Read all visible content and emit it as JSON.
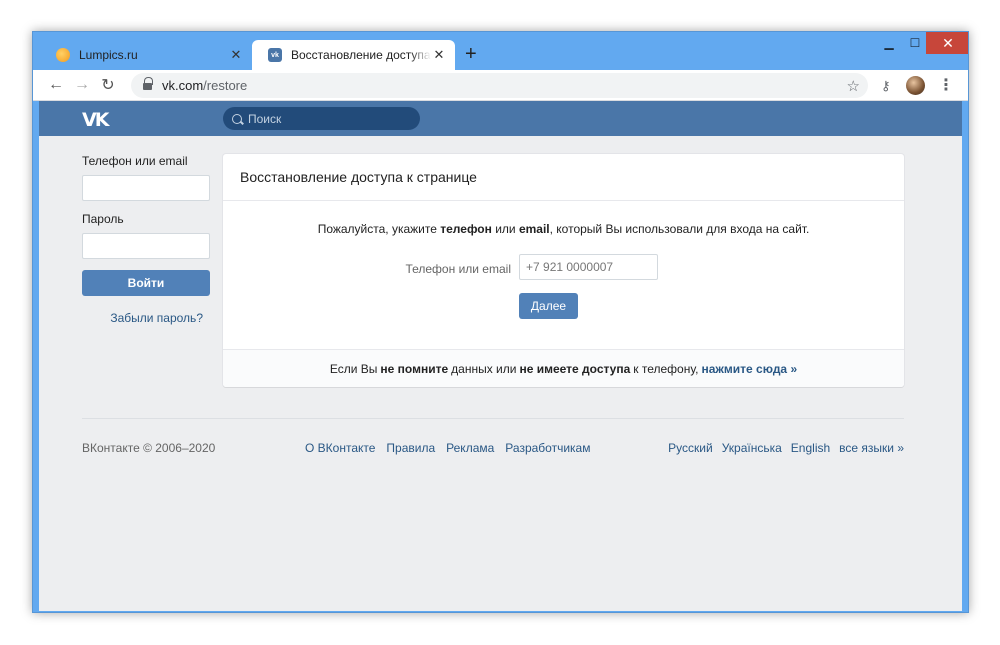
{
  "browser": {
    "tabs": [
      {
        "title": "Lumpics.ru",
        "favicon": "lumpics-favicon",
        "active": false
      },
      {
        "title": "Восстановление доступа к странице",
        "favicon": "vk-favicon",
        "active": true
      }
    ],
    "new_tab_label": "+",
    "close_glyph": "✕",
    "window_controls": {
      "minimize": "▁",
      "maximize": "☐",
      "close": "✕"
    },
    "nav": {
      "back": "←",
      "forward": "→",
      "reload": "↻"
    },
    "url": {
      "host": "vk.com",
      "path": "/restore"
    },
    "bookmark_icon": "☆",
    "key_icon": "🔑",
    "menu_icon": "⋮"
  },
  "vk": {
    "logo": "VK",
    "search_placeholder": "Поиск",
    "accent": "#4a76a8"
  },
  "login": {
    "phone_label": "Телефон или email",
    "password_label": "Пароль",
    "login_button": "Войти",
    "forgot_link": "Забыли пароль?"
  },
  "restore": {
    "title": "Восстановление доступа к странице",
    "instruction": {
      "part1": "Пожалуйста, укажите ",
      "bold1": "телефон",
      "part2": " или ",
      "bold2": "email",
      "part3": ", который Вы использовали для входа на сайт."
    },
    "field_label": "Телефон или email",
    "field_placeholder": "+7 921 0000007",
    "next_button": "Далее",
    "footer": {
      "part1": "Если Вы",
      "bold1": "не помните",
      "part2": "данных или",
      "bold2": "не имеете доступа",
      "part3": "к телефону,",
      "link": "нажмите сюда »"
    }
  },
  "footer": {
    "copyright": "ВКонтакте © 2006–2020",
    "links": [
      "О ВКонтакте",
      "Правила",
      "Реклама",
      "Разработчикам"
    ],
    "languages": [
      "Русский",
      "Українська",
      "English",
      "все языки »"
    ]
  }
}
